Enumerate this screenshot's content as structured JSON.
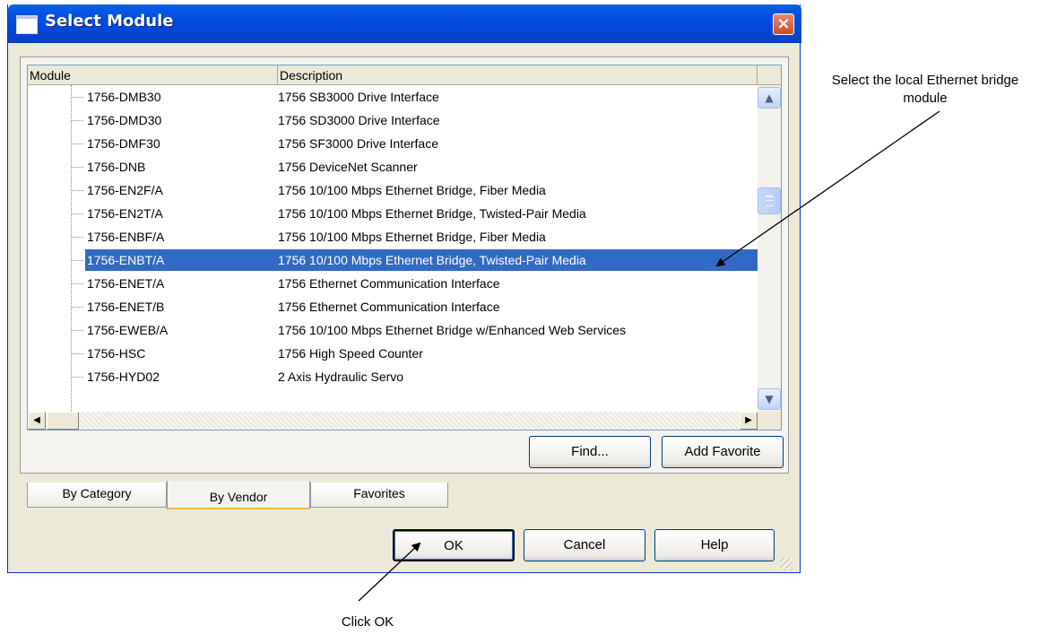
{
  "window": {
    "title": "Select Module",
    "close_symbol": "×"
  },
  "list": {
    "columns": [
      "Module",
      "Description"
    ],
    "rows": [
      {
        "module": "1756-DMB30",
        "description": "1756 SB3000 Drive Interface"
      },
      {
        "module": "1756-DMD30",
        "description": "1756 SD3000 Drive Interface"
      },
      {
        "module": "1756-DMF30",
        "description": "1756 SF3000 Drive Interface"
      },
      {
        "module": "1756-DNB",
        "description": "1756 DeviceNet Scanner"
      },
      {
        "module": "1756-EN2F/A",
        "description": "1756 10/100 Mbps Ethernet Bridge, Fiber Media"
      },
      {
        "module": "1756-EN2T/A",
        "description": "1756 10/100 Mbps Ethernet Bridge, Twisted-Pair Media"
      },
      {
        "module": "1756-ENBF/A",
        "description": "1756 10/100 Mbps Ethernet Bridge, Fiber Media"
      },
      {
        "module": "1756-ENBT/A",
        "description": "1756 10/100 Mbps Ethernet Bridge, Twisted-Pair Media"
      },
      {
        "module": "1756-ENET/A",
        "description": "1756 Ethernet Communication Interface"
      },
      {
        "module": "1756-ENET/B",
        "description": "1756 Ethernet Communication Interface"
      },
      {
        "module": "1756-EWEB/A",
        "description": "1756 10/100 Mbps Ethernet Bridge w/Enhanced Web Services"
      },
      {
        "module": "1756-HSC",
        "description": "1756 High Speed Counter"
      },
      {
        "module": "1756-HYD02",
        "description": "2 Axis Hydraulic Servo"
      }
    ],
    "selected_module": "1756-ENBT/A"
  },
  "buttons": {
    "find": "Find...",
    "add_favorite": "Add Favorite",
    "ok": "OK",
    "cancel": "Cancel",
    "help": "Help"
  },
  "tabs": {
    "by_category": "By Category",
    "by_vendor": "By Vendor",
    "favorites": "Favorites",
    "active": "By Vendor"
  },
  "annotations": {
    "select_note": "Select the local Ethernet bridge module",
    "ok_note": "Click OK"
  },
  "colors": {
    "selection": "#316ac5",
    "titlebar": "#0554e3",
    "close": "#cf4a22",
    "dialog_bg": "#ece9d8"
  },
  "icons": {
    "scroll_up": "▲",
    "scroll_down": "▼",
    "scroll_left": "◀",
    "scroll_right": "▶"
  }
}
